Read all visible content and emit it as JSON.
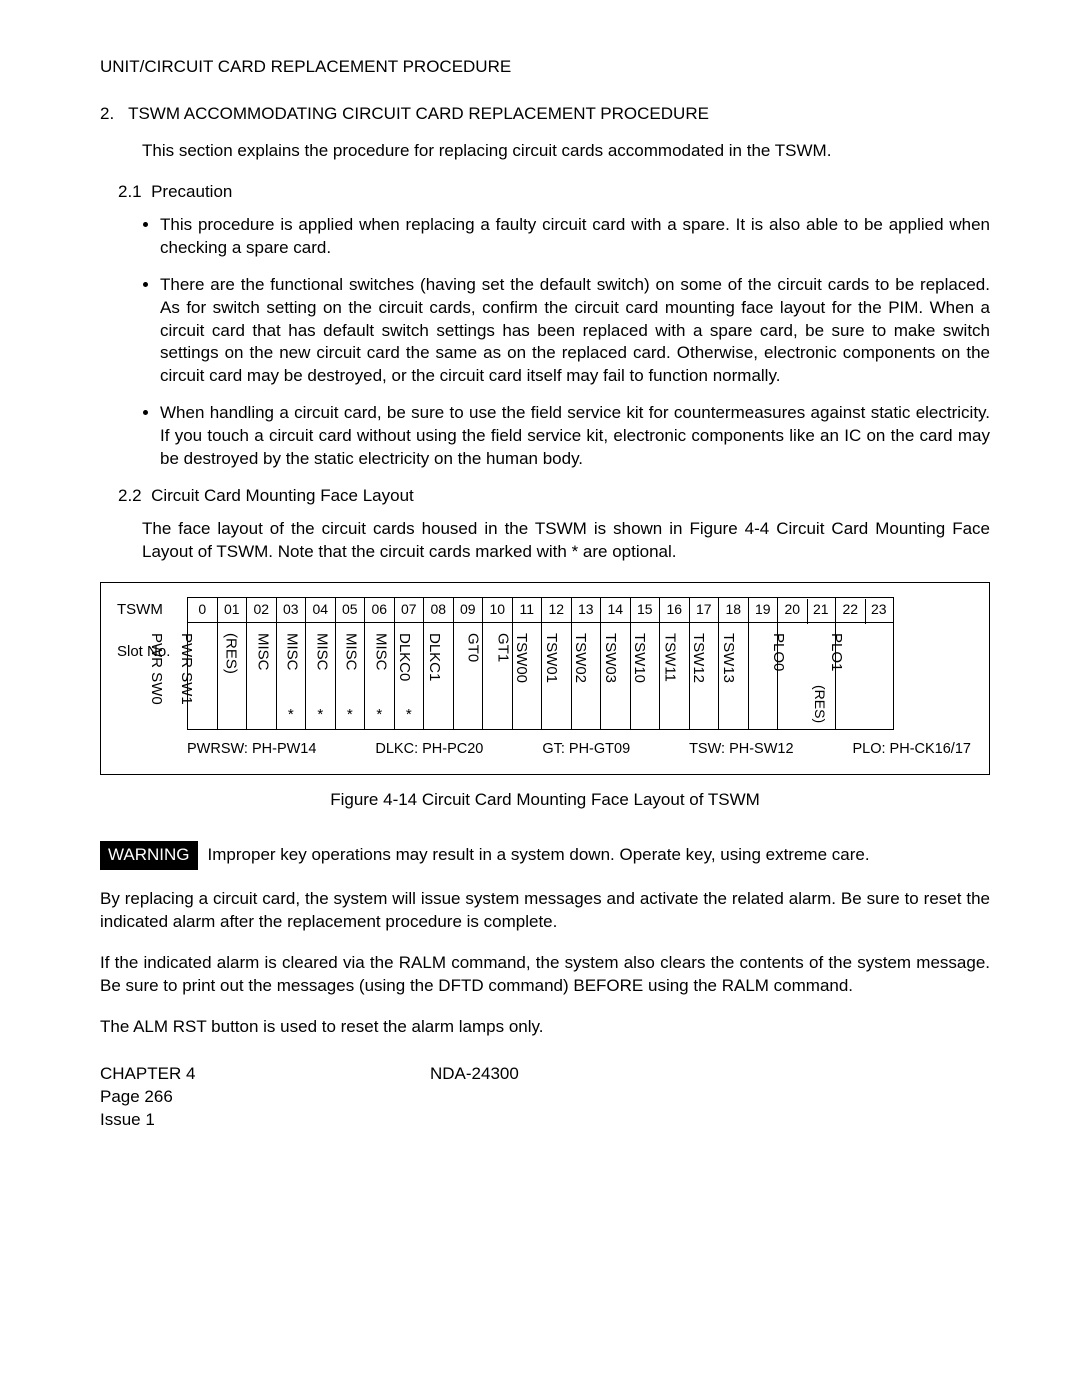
{
  "header": "UNIT/CIRCUIT CARD REPLACEMENT PROCEDURE",
  "section": {
    "num": "2.",
    "title": "TSWM ACCOMMODATING CIRCUIT CARD REPLACEMENT PROCEDURE",
    "intro": "This section explains the procedure for replacing circuit cards accommodated in the TSWM.",
    "s21_num": "2.1",
    "s21_title": "Precaution",
    "bullets": [
      "This procedure is applied when replacing a faulty circuit card with a spare. It is also able to be applied when checking a spare card.",
      "There are the functional switches (having set the default switch) on some of the circuit cards to be replaced. As for switch setting on the circuit cards, confirm the circuit card mounting face layout for the PIM. When a circuit card that has default switch settings has been replaced with a spare card, be sure to make switch settings on the new circuit card the same as on the replaced card. Otherwise, electronic components on the circuit card may be destroyed, or the circuit card itself may fail to function normally.",
      "When handling a circuit card, be sure to use the field service kit for countermeasures against static electricity. If you touch a circuit card without using the field service kit, electronic components like an IC on the card may be destroyed by the static electricity on the human body."
    ],
    "s22_num": "2.2",
    "s22_title": "Circuit Card Mounting Face Layout",
    "s22_text": "The face layout of the circuit cards housed in the TSWM is shown in Figure 4-4 Circuit Card Mounting Face Layout of TSWM. Note that the circuit cards marked with * are optional."
  },
  "figure": {
    "tswm_label": "TSWM",
    "slotno_label": "Slot No.",
    "slots": [
      {
        "num": "0",
        "label": "PWR SW0",
        "star": false
      },
      {
        "num": "01",
        "label": "PWR SW1",
        "star": false
      },
      {
        "num": "02",
        "label": "(RES)",
        "star": false
      },
      {
        "num": "03",
        "label": "MISC",
        "star": true
      },
      {
        "num": "04",
        "label": "MISC",
        "star": true
      },
      {
        "num": "05",
        "label": "MISC",
        "star": true
      },
      {
        "num": "06",
        "label": "MISC",
        "star": true
      },
      {
        "num": "07",
        "label": "MISC",
        "star": true
      },
      {
        "num": "08",
        "label": "DLKC0",
        "star": false
      },
      {
        "num": "09",
        "label": "DLKC1",
        "star": false
      },
      {
        "num": "10",
        "label": "GT0",
        "star": false
      },
      {
        "num": "11",
        "label": "GT1",
        "star": false
      },
      {
        "num": "12",
        "label": "TSW00",
        "star": false
      },
      {
        "num": "13",
        "label": "TSW01",
        "star": false
      },
      {
        "num": "14",
        "label": "TSW02",
        "star": false
      },
      {
        "num": "15",
        "label": "TSW03",
        "star": false
      },
      {
        "num": "16",
        "label": "TSW10",
        "star": false
      },
      {
        "num": "17",
        "label": "TSW11",
        "star": false
      },
      {
        "num": "18",
        "label": "TSW12",
        "star": false
      },
      {
        "num": "19",
        "label": "TSW13",
        "star": false
      }
    ],
    "wide_slots": [
      {
        "nums": [
          "20",
          "21"
        ],
        "label": "PLO0",
        "res": ""
      },
      {
        "nums": [
          "22",
          "23"
        ],
        "label": "PLO1",
        "res": "(RES)"
      }
    ],
    "bottom_labels": [
      "PWRSW: PH-PW14",
      "DLKC: PH-PC20",
      "GT: PH-GT09",
      "TSW: PH-SW12",
      "PLO: PH-CK16/17"
    ],
    "caption": "Figure 4-14   Circuit Card Mounting Face Layout of TSWM"
  },
  "warning": {
    "badge": "WARNING",
    "text": "Improper key operations may result in a system down. Operate key, using extreme care."
  },
  "paras": [
    "By replacing a circuit card, the system will issue system messages and activate the related alarm. Be sure to reset the indicated alarm after the replacement procedure is complete.",
    "If the indicated alarm is cleared via the RALM command, the system also clears the contents of the system message. Be sure to print out the messages (using the DFTD command) BEFORE using the RALM command.",
    "The ALM RST button is used to reset the alarm lamps only."
  ],
  "footer": {
    "chapter": "CHAPTER 4",
    "page": "Page 266",
    "issue": "Issue 1",
    "doc": "NDA-24300"
  }
}
